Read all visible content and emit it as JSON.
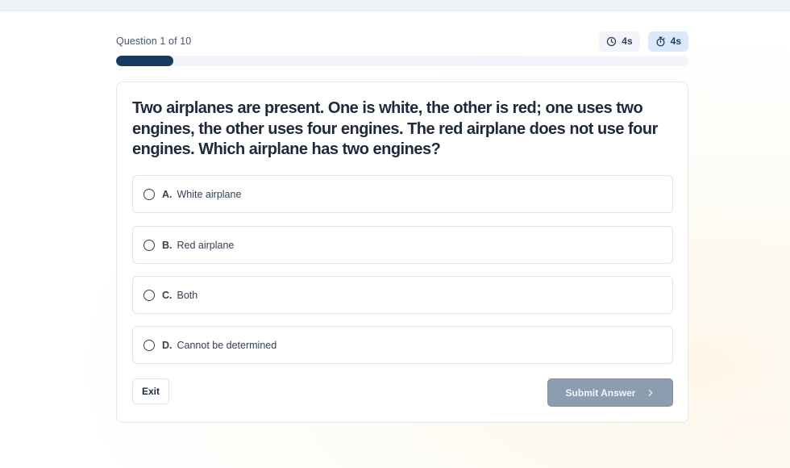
{
  "header": {
    "question_counter": "Question 1 of 10",
    "timers": {
      "clock_value": "4s",
      "stopwatch_value": "4s"
    }
  },
  "progress": {
    "current": 1,
    "total": 10
  },
  "question": {
    "text": "Two airplanes are present. One is white, the other is red; one uses two engines, the other uses four engines. The red airplane does not use four engines. Which airplane has two engines?"
  },
  "options": [
    {
      "letter": "A.",
      "text": "White airplane"
    },
    {
      "letter": "B.",
      "text": "Red airplane"
    },
    {
      "letter": "C.",
      "text": "Both"
    },
    {
      "letter": "D.",
      "text": "Cannot be determined"
    }
  ],
  "actions": {
    "exit_label": "Exit",
    "submit_label": "Submit Answer"
  },
  "colors": {
    "progress_fill": "#173a63",
    "submit_disabled": "#8d9db0",
    "stopwatch_badge": "#dbe9f8"
  },
  "icons": {
    "clock": "clock-icon",
    "stopwatch": "stopwatch-icon",
    "submit_arrow": "chevron-right-icon"
  }
}
